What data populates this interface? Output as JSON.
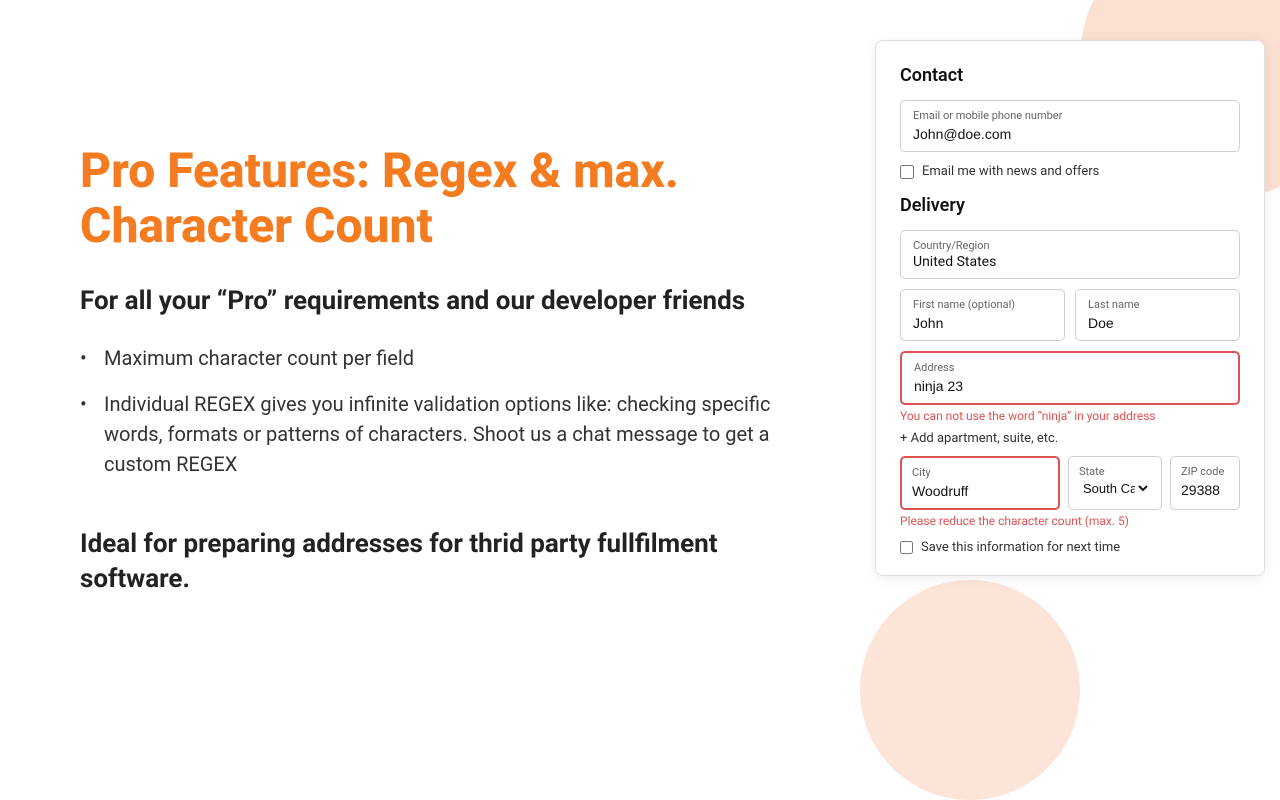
{
  "decorative": {
    "circle_top_right": true,
    "circle_bottom_right": true
  },
  "left": {
    "title": "Pro Features: Regex & max. Character Count",
    "subtitle": "For all your “Pro” requirements and our developer friends",
    "bullets": [
      "Maximum character count per field",
      "Individual REGEX gives you infinite validation options like: checking specific words, formats or patterns of characters. Shoot us a chat message to get a custom REGEX"
    ],
    "ideal_text": "Ideal for preparing addresses for thrid party fullfilment  software."
  },
  "form": {
    "contact_section": "Contact",
    "email_label": "Email or mobile phone number",
    "email_value": "John@doe.com",
    "email_checkbox_label": "Email me with news and offers",
    "delivery_section": "Delivery",
    "country_label": "Country/Region",
    "country_value": "United States",
    "first_name_label": "First name (optional)",
    "first_name_value": "John",
    "last_name_label": "Last name",
    "last_name_value": "Doe",
    "address_label": "Address",
    "address_value": "ninja 23",
    "address_error": "You can not use the word “ninja” in your address",
    "add_apt_label": "+ Add apartment, suite, etc.",
    "city_label": "City",
    "city_value": "Woodruff",
    "city_error": "Please reduce the character count (max. 5)",
    "state_label": "State",
    "state_value": "South Carolina",
    "zip_label": "ZIP code",
    "zip_value": "29388",
    "save_checkbox_label": "Save this information for next time"
  }
}
